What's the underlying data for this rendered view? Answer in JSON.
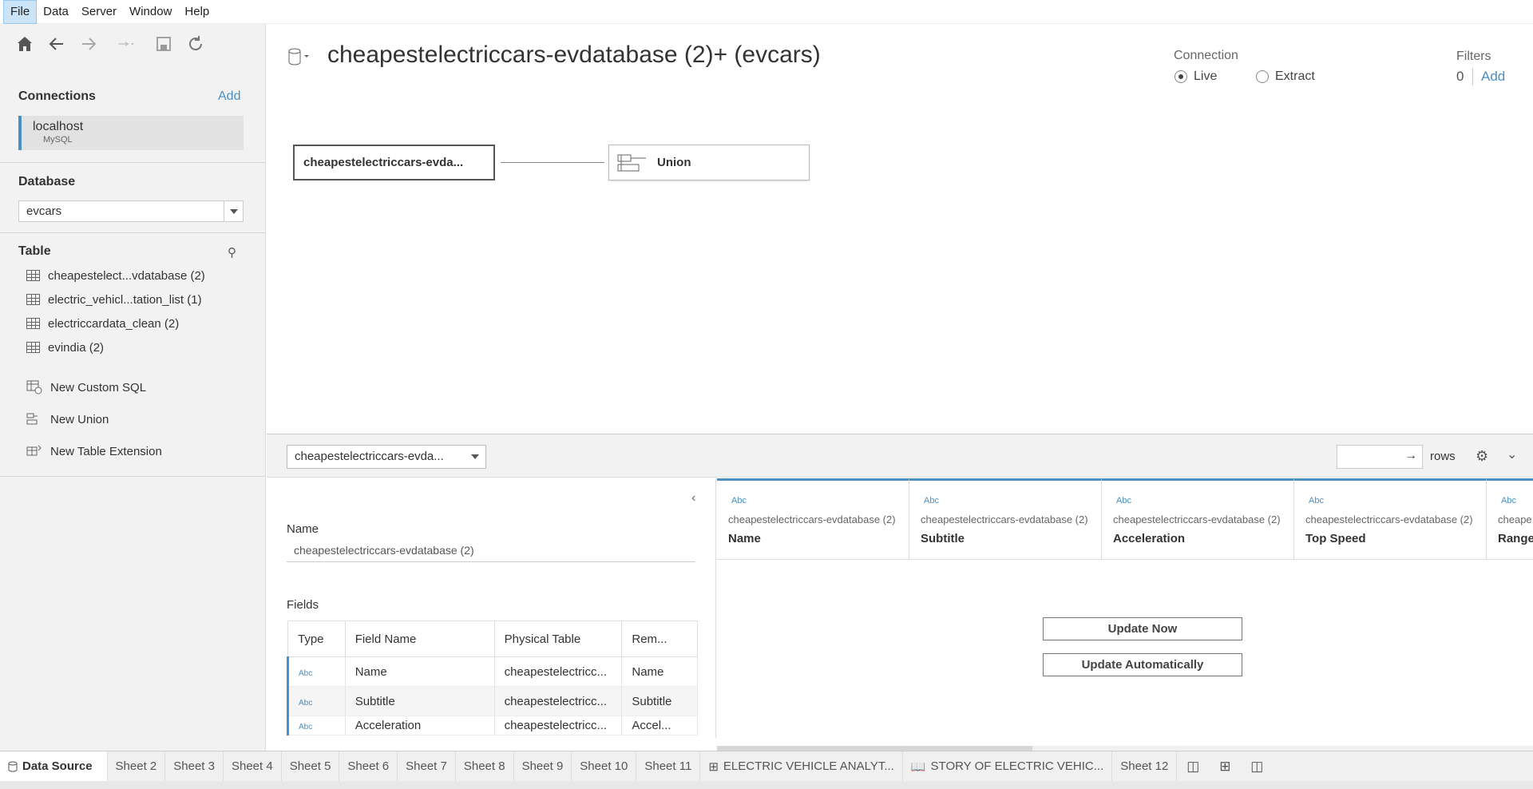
{
  "menu": [
    "File",
    "Data",
    "Server",
    "Window",
    "Help"
  ],
  "sidebar": {
    "connections_title": "Connections",
    "add_label": "Add",
    "connection": {
      "name": "localhost",
      "type": "MySQL"
    },
    "database_title": "Database",
    "database_value": "evcars",
    "table_title": "Table",
    "tables": [
      "cheapestelect...vdatabase (2)",
      "electric_vehicl...tation_list (1)",
      "electriccardata_clean (2)",
      "evindia (2)"
    ],
    "actions": [
      "New Custom SQL",
      "New Union",
      "New Table Extension"
    ]
  },
  "main": {
    "title": "cheapestelectriccars-evdatabase (2)+ (evcars)",
    "connection_label": "Connection",
    "live_label": "Live",
    "extract_label": "Extract",
    "filters_label": "Filters",
    "filters_count": "0",
    "filters_add": "Add",
    "node_left": "cheapestelectriccars-evda...",
    "node_right": "Union"
  },
  "lower": {
    "table_dropdown": "cheapestelectriccars-evda...",
    "rows_label": "rows",
    "name_label": "Name",
    "name_value": "cheapestelectriccars-evdatabase (2)",
    "fields_label": "Fields",
    "fields_headers": [
      "Type",
      "Field Name",
      "Physical Table",
      "Rem..."
    ],
    "fields_rows": [
      {
        "type": "Abc",
        "name": "Name",
        "table": "cheapestelectricc...",
        "remote": "Name"
      },
      {
        "type": "Abc",
        "name": "Subtitle",
        "table": "cheapestelectricc...",
        "remote": "Subtitle"
      },
      {
        "type": "Abc",
        "name": "Acceleration",
        "table": "cheapestelectricc...",
        "remote": "Accel..."
      }
    ],
    "grid_columns": [
      {
        "type": "Abc",
        "source": "cheapestelectriccars-evdatabase (2)",
        "field": "Name"
      },
      {
        "type": "Abc",
        "source": "cheapestelectriccars-evdatabase (2)",
        "field": "Subtitle"
      },
      {
        "type": "Abc",
        "source": "cheapestelectriccars-evdatabase (2)",
        "field": "Acceleration"
      },
      {
        "type": "Abc",
        "source": "cheapestelectriccars-evdatabase (2)",
        "field": "Top Speed"
      },
      {
        "type": "Abc",
        "source": "cheape",
        "field": "Range"
      }
    ],
    "update_now": "Update Now",
    "update_auto": "Update Automatically"
  },
  "tabs": {
    "data_source": "Data Source",
    "sheets": [
      "Sheet 2",
      "Sheet 3",
      "Sheet 4",
      "Sheet 5",
      "Sheet 6",
      "Sheet 7",
      "Sheet 8",
      "Sheet 9",
      "Sheet 10",
      "Sheet 11"
    ],
    "dashboard": "ELECTRIC VEHICLE ANALYT...",
    "story": "STORY OF ELECTRIC VEHIC...",
    "last_sheet": "Sheet 12"
  },
  "colors": {
    "accent": "#4a90c2",
    "sidebar_bg": "#f2f2f2"
  }
}
